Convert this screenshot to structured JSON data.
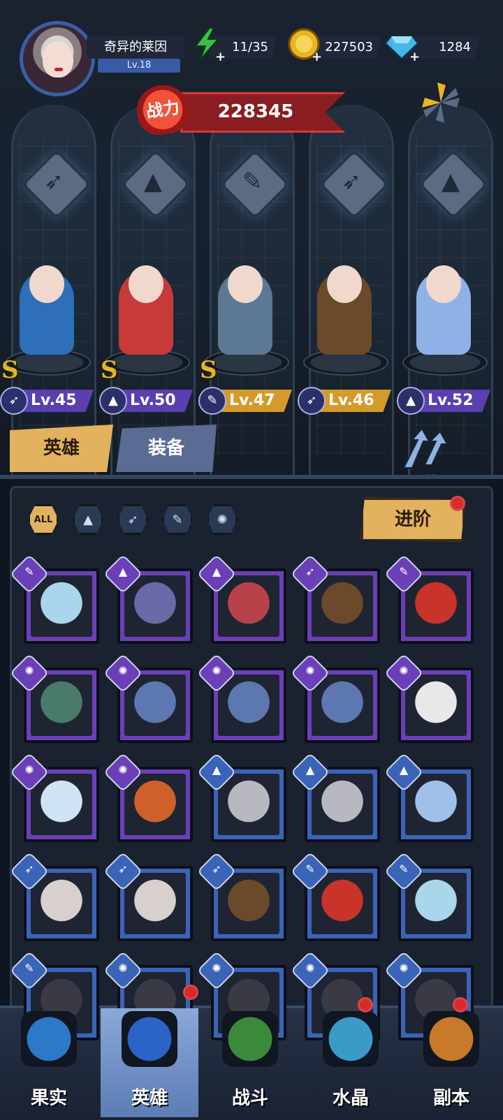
{
  "player": {
    "name": "奇异的莱因",
    "level": "Lv.18"
  },
  "resources": {
    "energy": "11/35",
    "gold": "227503",
    "gems": "1284"
  },
  "power": {
    "label": "战力",
    "value": "228345"
  },
  "lineup": [
    {
      "grade": "S",
      "class_icon": "wing-class-icon",
      "level": "Lv.45",
      "strip_color": "#5a3fb0",
      "body_color": "#2d6fb8"
    },
    {
      "grade": "S",
      "class_icon": "hat-class-icon",
      "level": "Lv.50",
      "strip_color": "#5a3fb0",
      "body_color": "#c83a3a"
    },
    {
      "grade": "S",
      "class_icon": "wrench-class-icon",
      "level": "Lv.47",
      "strip_color": "#d49a2a",
      "body_color": "#5d7893"
    },
    {
      "grade": "",
      "class_icon": "wing-class-icon",
      "level": "Lv.46",
      "strip_color": "#d49a2a",
      "body_color": "#6a4a2a"
    },
    {
      "grade": "",
      "class_icon": "hat-class-icon",
      "level": "Lv.52",
      "strip_color": "#5a3fb0",
      "body_color": "#8fb2e6"
    }
  ],
  "tabs": {
    "hero": "英雄",
    "equip": "装备",
    "bond": "羁绊"
  },
  "filters": {
    "all": "ALL"
  },
  "advance_label": "进阶",
  "cards": [
    {
      "cls": "wrench-class-icon",
      "frame": "#6b3fb8",
      "art": "#a9d6ea"
    },
    {
      "cls": "hat-class-icon",
      "frame": "#6b3fb8",
      "art": "#6a6aa8"
    },
    {
      "cls": "hat-class-icon",
      "frame": "#6b3fb8",
      "art": "#b8424a"
    },
    {
      "cls": "wing-class-icon",
      "frame": "#6b3fb8",
      "art": "#6a4a2a"
    },
    {
      "cls": "wrench-class-icon",
      "frame": "#6b3fb8",
      "art": "#c8332a"
    },
    {
      "cls": "claw-class-icon",
      "frame": "#6b3fb8",
      "art": "#4a7a6a"
    },
    {
      "cls": "claw-class-icon",
      "frame": "#6b3fb8",
      "art": "#5d78b0"
    },
    {
      "cls": "claw-class-icon",
      "frame": "#6b3fb8",
      "art": "#5d78b0"
    },
    {
      "cls": "claw-class-icon",
      "frame": "#6b3fb8",
      "art": "#5d78b0"
    },
    {
      "cls": "claw-class-icon",
      "frame": "#6b3fb8",
      "art": "#e8e8e8"
    },
    {
      "cls": "claw-class-icon",
      "frame": "#6b3fb8",
      "art": "#cfe4f2"
    },
    {
      "cls": "claw-class-icon",
      "frame": "#6b3fb8",
      "art": "#d0602a"
    },
    {
      "cls": "hat-class-icon",
      "frame": "#3a64b8",
      "art": "#b8b8c0"
    },
    {
      "cls": "hat-class-icon",
      "frame": "#3a64b8",
      "art": "#b8b8c0"
    },
    {
      "cls": "hat-class-icon",
      "frame": "#3a64b8",
      "art": "#9fc0e8"
    },
    {
      "cls": "wing-class-icon",
      "frame": "#3a64b8",
      "art": "#d8d0cc"
    },
    {
      "cls": "wing-class-icon",
      "frame": "#3a64b8",
      "art": "#d8d0cc"
    },
    {
      "cls": "wing-class-icon",
      "frame": "#3a64b8",
      "art": "#6a4a2a"
    },
    {
      "cls": "wrench-class-icon",
      "frame": "#3a64b8",
      "art": "#c8332a"
    },
    {
      "cls": "wrench-class-icon",
      "frame": "#3a64b8",
      "art": "#a9d6ea"
    },
    {
      "cls": "wrench-class-icon",
      "frame": "#3a64b8",
      "art": "#3a3a44"
    },
    {
      "cls": "claw-class-icon",
      "frame": "#3a64b8",
      "art": "#3a3a44"
    },
    {
      "cls": "claw-class-icon",
      "frame": "#3a64b8",
      "art": "#3a3a44"
    },
    {
      "cls": "claw-class-icon",
      "frame": "#3a64b8",
      "art": "#3a3a44"
    },
    {
      "cls": "claw-class-icon",
      "frame": "#3a64b8",
      "art": "#3a3a44"
    },
    {
      "cls": "claw-class-icon",
      "frame": "#3a64b8",
      "art": "#6a4a3a"
    }
  ],
  "nav": [
    {
      "label": "果实",
      "icon": "fruit-icon",
      "color": "#2d78c8"
    },
    {
      "label": "英雄",
      "icon": "hero-hat-icon",
      "color": "#2a64c8"
    },
    {
      "label": "战斗",
      "icon": "battle-sword-icon",
      "color": "#3a8a3a"
    },
    {
      "label": "水晶",
      "icon": "crystal-icon",
      "color": "#3a9ac8"
    },
    {
      "label": "副本",
      "icon": "dungeon-portal-icon",
      "color": "#c87a2a"
    }
  ],
  "colors": {
    "accent_gold": "#e2b25e",
    "power_red": "#8a1d22",
    "purple_frame": "#6b3fb8",
    "blue_frame": "#3a64b8"
  }
}
